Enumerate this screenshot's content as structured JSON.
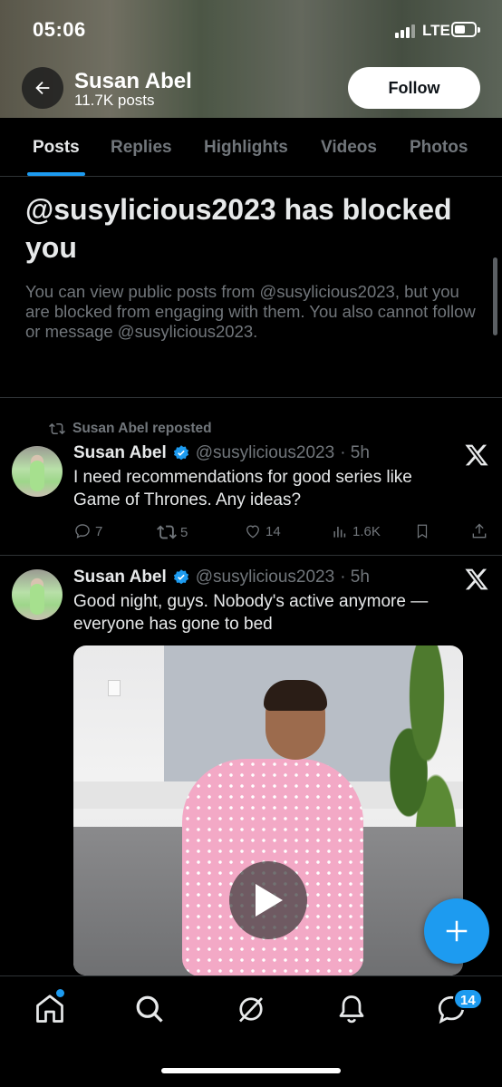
{
  "status_bar": {
    "time": "05:06",
    "network": "LTE"
  },
  "header": {
    "name": "Susan Abel",
    "posts_count": "11.7K posts",
    "follow_label": "Follow"
  },
  "tabs": [
    {
      "label": "Posts",
      "active": true
    },
    {
      "label": "Replies"
    },
    {
      "label": "Highlights"
    },
    {
      "label": "Videos"
    },
    {
      "label": "Photos"
    }
  ],
  "blocked": {
    "title": "@susylicious2023 has blocked you",
    "description": "You can view public posts from @susylicious2023, but you are blocked from engaging with them. You also cannot follow or message @susylicious2023."
  },
  "posts": [
    {
      "repost_label": "Susan Abel reposted",
      "name": "Susan Abel",
      "handle": "@susylicious2023",
      "time": "· 5h",
      "text": "I need recommendations for good series like Game of Thrones. Any ideas?",
      "replies": "7",
      "reposts": "5",
      "likes": "14",
      "views": "1.6K"
    },
    {
      "name": "Susan Abel",
      "handle": "@susylicious2023",
      "time": "· 5h",
      "text": "Good night, guys. Nobody's active anymore — everyone has gone to bed"
    }
  ],
  "bottom_nav": {
    "messages_badge": "14"
  },
  "colors": {
    "accent": "#1d9bf0",
    "background": "#000000",
    "muted": "#71767b"
  }
}
